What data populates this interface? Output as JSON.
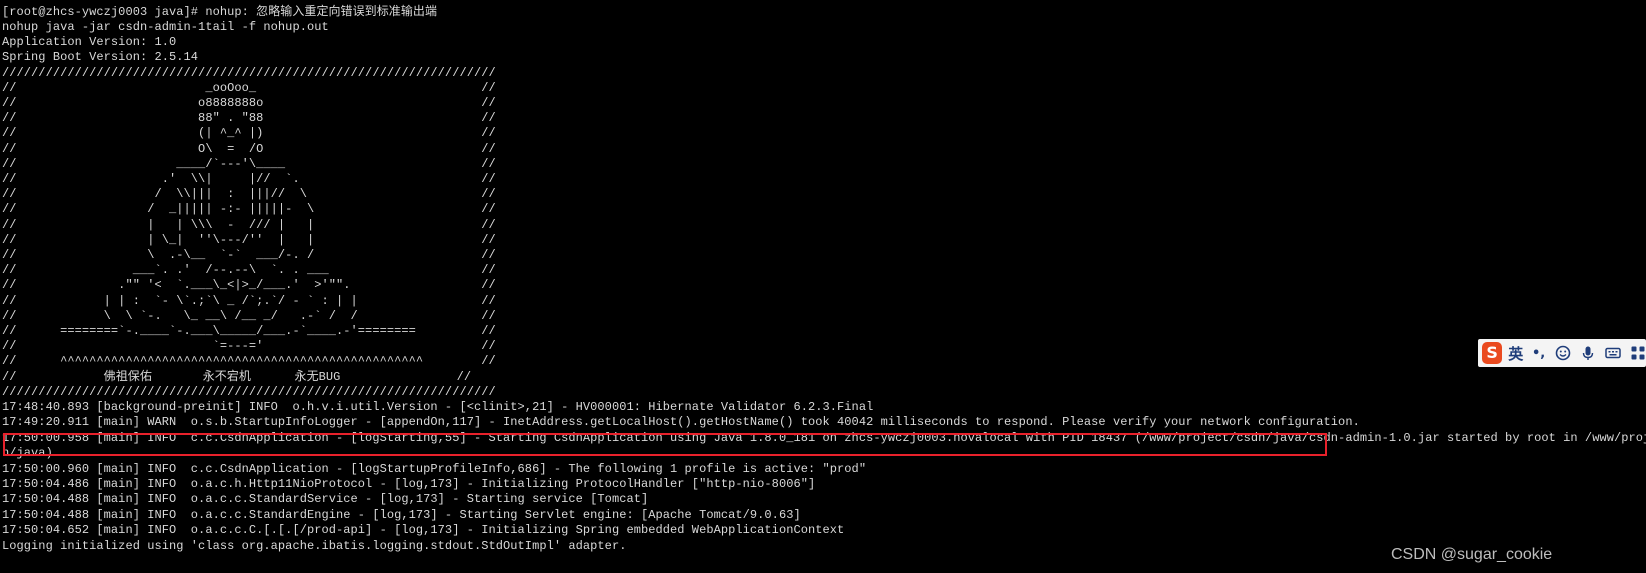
{
  "terminal": {
    "lines": [
      "[root@zhcs-ywczj0003 java]# nohup: 忽略输入重定向错误到标准输出端",
      "nohup java -jar csdn-admin-1tail -f nohup.out",
      "Application Version: 1.0",
      "Spring Boot Version: 2.5.14",
      "////////////////////////////////////////////////////////////////////",
      "//                          _ooOoo_                               //",
      "//                         o8888888o                              //",
      "//                         88\" . \"88                              //",
      "//                         (| ^_^ |)                              //",
      "//                         O\\  =  /O                              //",
      "//                      ____/`---'\\____                           //",
      "//                    .'  \\\\|     |//  `.                         //",
      "//                   /  \\\\|||  :  |||//  \\                        //",
      "//                  /  _||||| -:- |||||-  \\                       //",
      "//                  |   | \\\\\\  -  /// |   |                       //",
      "//                  | \\_|  ''\\---/''  |   |                       //",
      "//                  \\  .-\\__  `-`  ___/-. /                       //",
      "//                ___`. .'  /--.--\\  `. . ___                     //",
      "//              .\"\" '<  `.___\\_<|>_/___.'  >'\"\".                  //",
      "//            | | :  `- \\`.;`\\ _ /`;.`/ - ` : | |                 //",
      "//            \\  \\ `-.   \\_ __\\ /__ _/   .-` /  /                 //",
      "//      ========`-.____`-.___\\_____/___.-`____.-'========         //",
      "//                           `=---='                              //",
      "//      ^^^^^^^^^^^^^^^^^^^^^^^^^^^^^^^^^^^^^^^^^^^^^^^^^^        //",
      "//            佛祖保佑       永不宕机      永无BUG                //",
      "////////////////////////////////////////////////////////////////////",
      "17:48:40.893 [background-preinit] INFO  o.h.v.i.util.Version - [<clinit>,21] - HV000001: Hibernate Validator 6.2.3.Final",
      "17:49:20.911 [main] WARN  o.s.b.StartupInfoLogger - [appendOn,117] - InetAddress.getLocalHost().getHostName() took 40042 milliseconds to respond. Please verify your network configuration.",
      "17:50:00.958 [main] INFO  c.c.CsdnApplication - [logStarting,55] - Starting CsdnApplication using Java 1.8.0_181 on zhcs-ywczj0003.novalocal with PID 18437 (/www/project/csdn/java/csdn-admin-1.0.jar started by root in /www/project/csd",
      "n/java)",
      "17:50:00.960 [main] INFO  c.c.CsdnApplication - [logStartupProfileInfo,686] - The following 1 profile is active: \"prod\"",
      "17:50:04.486 [main] INFO  o.a.c.h.Http11NioProtocol - [log,173] - Initializing ProtocolHandler [\"http-nio-8006\"]",
      "17:50:04.488 [main] INFO  o.a.c.c.StandardService - [log,173] - Starting service [Tomcat]",
      "17:50:04.488 [main] INFO  o.a.c.c.StandardEngine - [log,173] - Starting Servlet engine: [Apache Tomcat/9.0.63]",
      "17:50:04.652 [main] INFO  o.a.c.c.C.[.[.[/prod-api] - [log,173] - Initializing Spring embedded WebApplicationContext",
      "Logging initialized using 'class org.apache.ibatis.logging.stdout.StdOutImpl' adapter."
    ],
    "highlight_color": "#e8212b",
    "text_color": "#d9d9d9",
    "background": "#000000"
  },
  "ime_toolbar": {
    "logo": "S",
    "language": "英",
    "punctuation": "•,",
    "icons": [
      "emoji-icon",
      "microphone-icon",
      "keyboard-icon",
      "grid-menu-icon"
    ]
  },
  "watermark": "CSDN @sugar_cookie"
}
